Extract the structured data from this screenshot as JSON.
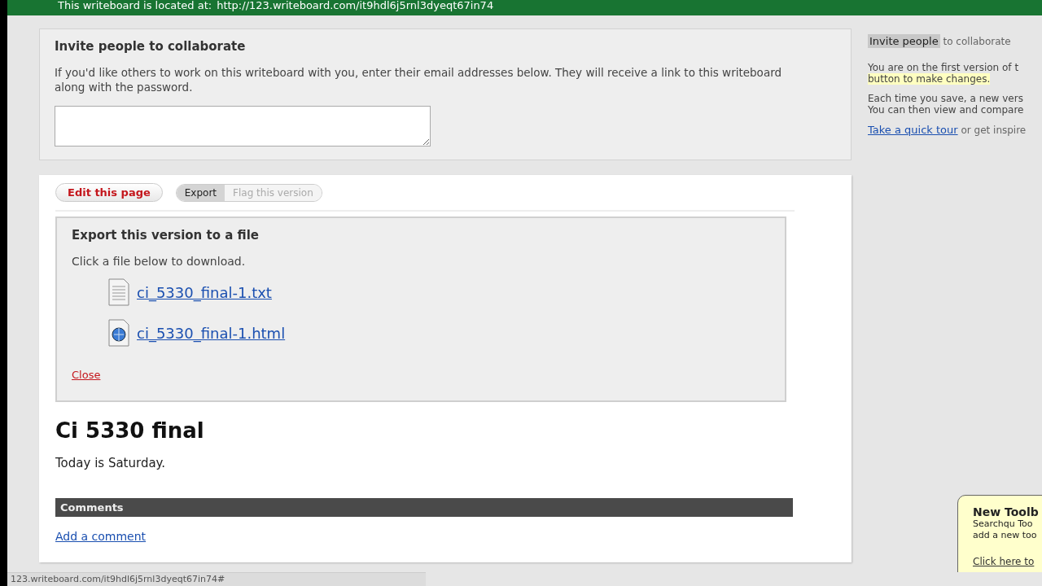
{
  "banner": {
    "text": "This writeboard is located at:",
    "link": "http://123.writeboard.com/it9hdl6j5rnl3dyeqt67in74"
  },
  "invite": {
    "title": "Invite people to collaborate",
    "description": "If you'd like others to work on this writeboard with you, enter their email addresses below. They will receive a link to this writeboard along with the password."
  },
  "toolbar": {
    "edit_button": "Edit this page",
    "tabs": [
      {
        "label": "Export",
        "selected": true
      },
      {
        "label": "Flag this version",
        "selected": false
      }
    ]
  },
  "export": {
    "title": "Export this version to a file",
    "instruction": "Click a file below to download.",
    "files": [
      {
        "kind": "text",
        "name": "ci_5330_final-1.txt"
      },
      {
        "kind": "html",
        "name": "ci_5330_final-1.html"
      }
    ],
    "close": "Close"
  },
  "document": {
    "title": "Ci 5330 final",
    "body": "Today is Saturday."
  },
  "comments": {
    "header": "Comments",
    "add_link": "Add a comment"
  },
  "sidebar": {
    "invite_link": "Invite people",
    "invite_suffix": "to collaborate",
    "version_note": "You are on the first version of t",
    "version_highlight": "button to make changes.",
    "save_lines": [
      "Each time you save, a new vers",
      "You can then view and compare"
    ],
    "tour_link": "Take a quick tour",
    "tour_suffix": "or get inspire"
  },
  "popup": {
    "title": "New Toolb",
    "lines": [
      "Searchqu Too",
      "add a new too"
    ],
    "link": "Click here to"
  },
  "status_bar": {
    "text": "123.writeboard.com/it9hdl6j5rnl3dyeqt67in74#"
  }
}
